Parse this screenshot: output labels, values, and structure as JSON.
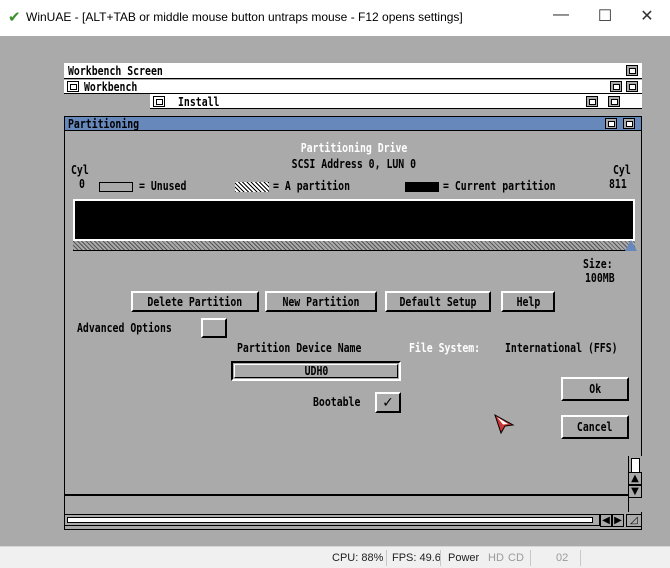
{
  "host": {
    "title": "WinUAE - [ALT+TAB or middle mouse button untraps mouse - F12 opens settings]",
    "icons": {
      "app": "winuae-check-icon",
      "minimize": "minimize-icon",
      "maximize": "maximize-icon",
      "close": "close-icon"
    }
  },
  "status": {
    "cpu": "CPU: 88%",
    "fps": "FPS: 49.6",
    "power": "Power",
    "hd": "HD",
    "cd": "CD",
    "drive": "02"
  },
  "screen": {
    "title": "Workbench Screen",
    "workbench_window": "Workbench",
    "install_window": "Install"
  },
  "partitioning": {
    "window_title": "Partitioning",
    "heading": "Partitioning Drive",
    "address": "SCSI Address 0, LUN 0",
    "cyl_left_label": "Cyl",
    "cyl_left_value": "0",
    "cyl_right_label": "Cyl",
    "cyl_right_value": "811",
    "legend_unused": "= Unused",
    "legend_partition": "= A partition",
    "legend_current": "= Current partition",
    "size_label": "Size:",
    "size_value": "100MB",
    "buttons": {
      "delete": "Delete Partition",
      "new": "New Partition",
      "default": "Default Setup",
      "help": "Help",
      "ok": "Ok",
      "cancel": "Cancel"
    },
    "advanced_options": "Advanced Options",
    "device_name_label": "Partition Device Name",
    "device_name_value": "UDH0",
    "file_system_label": "File System:",
    "file_system_value": "International (FFS)",
    "bootable_label": "Bootable",
    "bootable_checked": "✓"
  },
  "colors": {
    "amiga_bg": "#aaaaaa",
    "title_blue": "#6688bb",
    "file_system_label": "#ffffff",
    "pointer": "#cc3333"
  }
}
